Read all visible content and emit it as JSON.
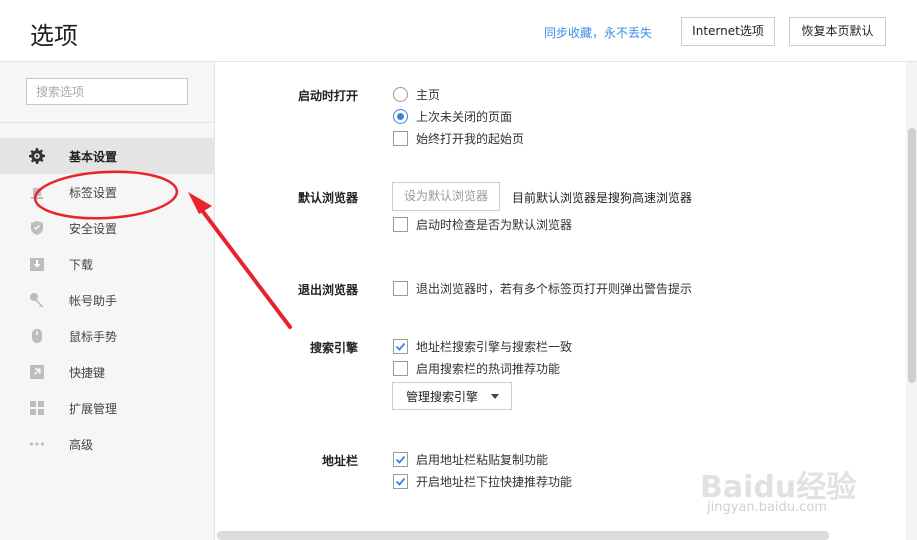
{
  "header": {
    "title": "选项",
    "sync_link": "同步收藏，永不丢失",
    "ie_button": "Internet选项",
    "reset_button": "恢复本页默认"
  },
  "sidebar": {
    "search_placeholder": "搜索选项",
    "items": [
      {
        "label": "基本设置",
        "icon": "gear-icon",
        "active": true
      },
      {
        "label": "标签设置",
        "icon": "tab-icon",
        "active": false
      },
      {
        "label": "安全设置",
        "icon": "shield-icon",
        "active": false
      },
      {
        "label": "下载",
        "icon": "download-icon",
        "active": false
      },
      {
        "label": "帐号助手",
        "icon": "key-icon",
        "active": false
      },
      {
        "label": "鼠标手势",
        "icon": "mouse-icon",
        "active": false
      },
      {
        "label": "快捷键",
        "icon": "shortcut-icon",
        "active": false
      },
      {
        "label": "扩展管理",
        "icon": "extensions-icon",
        "active": false
      },
      {
        "label": "高级",
        "icon": "more-icon",
        "active": false
      }
    ]
  },
  "main": {
    "startup": {
      "label": "启动时打开",
      "options": [
        {
          "label": "主页",
          "type": "radio",
          "checked": false
        },
        {
          "label": "上次未关闭的页面",
          "type": "radio",
          "checked": true
        },
        {
          "label": "始终打开我的起始页",
          "type": "checkbox",
          "checked": false
        }
      ]
    },
    "default_browser": {
      "label": "默认浏览器",
      "button": "设为默认浏览器",
      "status": "目前默认浏览器是搜狗高速浏览器",
      "check_option": "启动时检查是否为默认浏览器",
      "check_checked": false
    },
    "exit": {
      "label": "退出浏览器",
      "option": "退出浏览器时，若有多个标签页打开则弹出警告提示",
      "checked": false
    },
    "search_engine": {
      "label": "搜索引擎",
      "options": [
        {
          "label": "地址栏搜索引擎与搜索栏一致",
          "checked": true
        },
        {
          "label": "启用搜索栏的热词推荐功能",
          "checked": false
        }
      ],
      "manage_select": "管理搜索引擎"
    },
    "address_bar": {
      "label": "地址栏",
      "options": [
        {
          "label": "启用地址栏粘贴复制功能",
          "checked": true
        },
        {
          "label": "开启地址栏下拉快捷推荐功能",
          "checked": true
        }
      ]
    }
  },
  "colors": {
    "accent": "#3a86d8",
    "annotation": "#e8232b"
  },
  "watermark": {
    "brand": "Baidu经验",
    "url": "jingyan.baidu.com"
  }
}
